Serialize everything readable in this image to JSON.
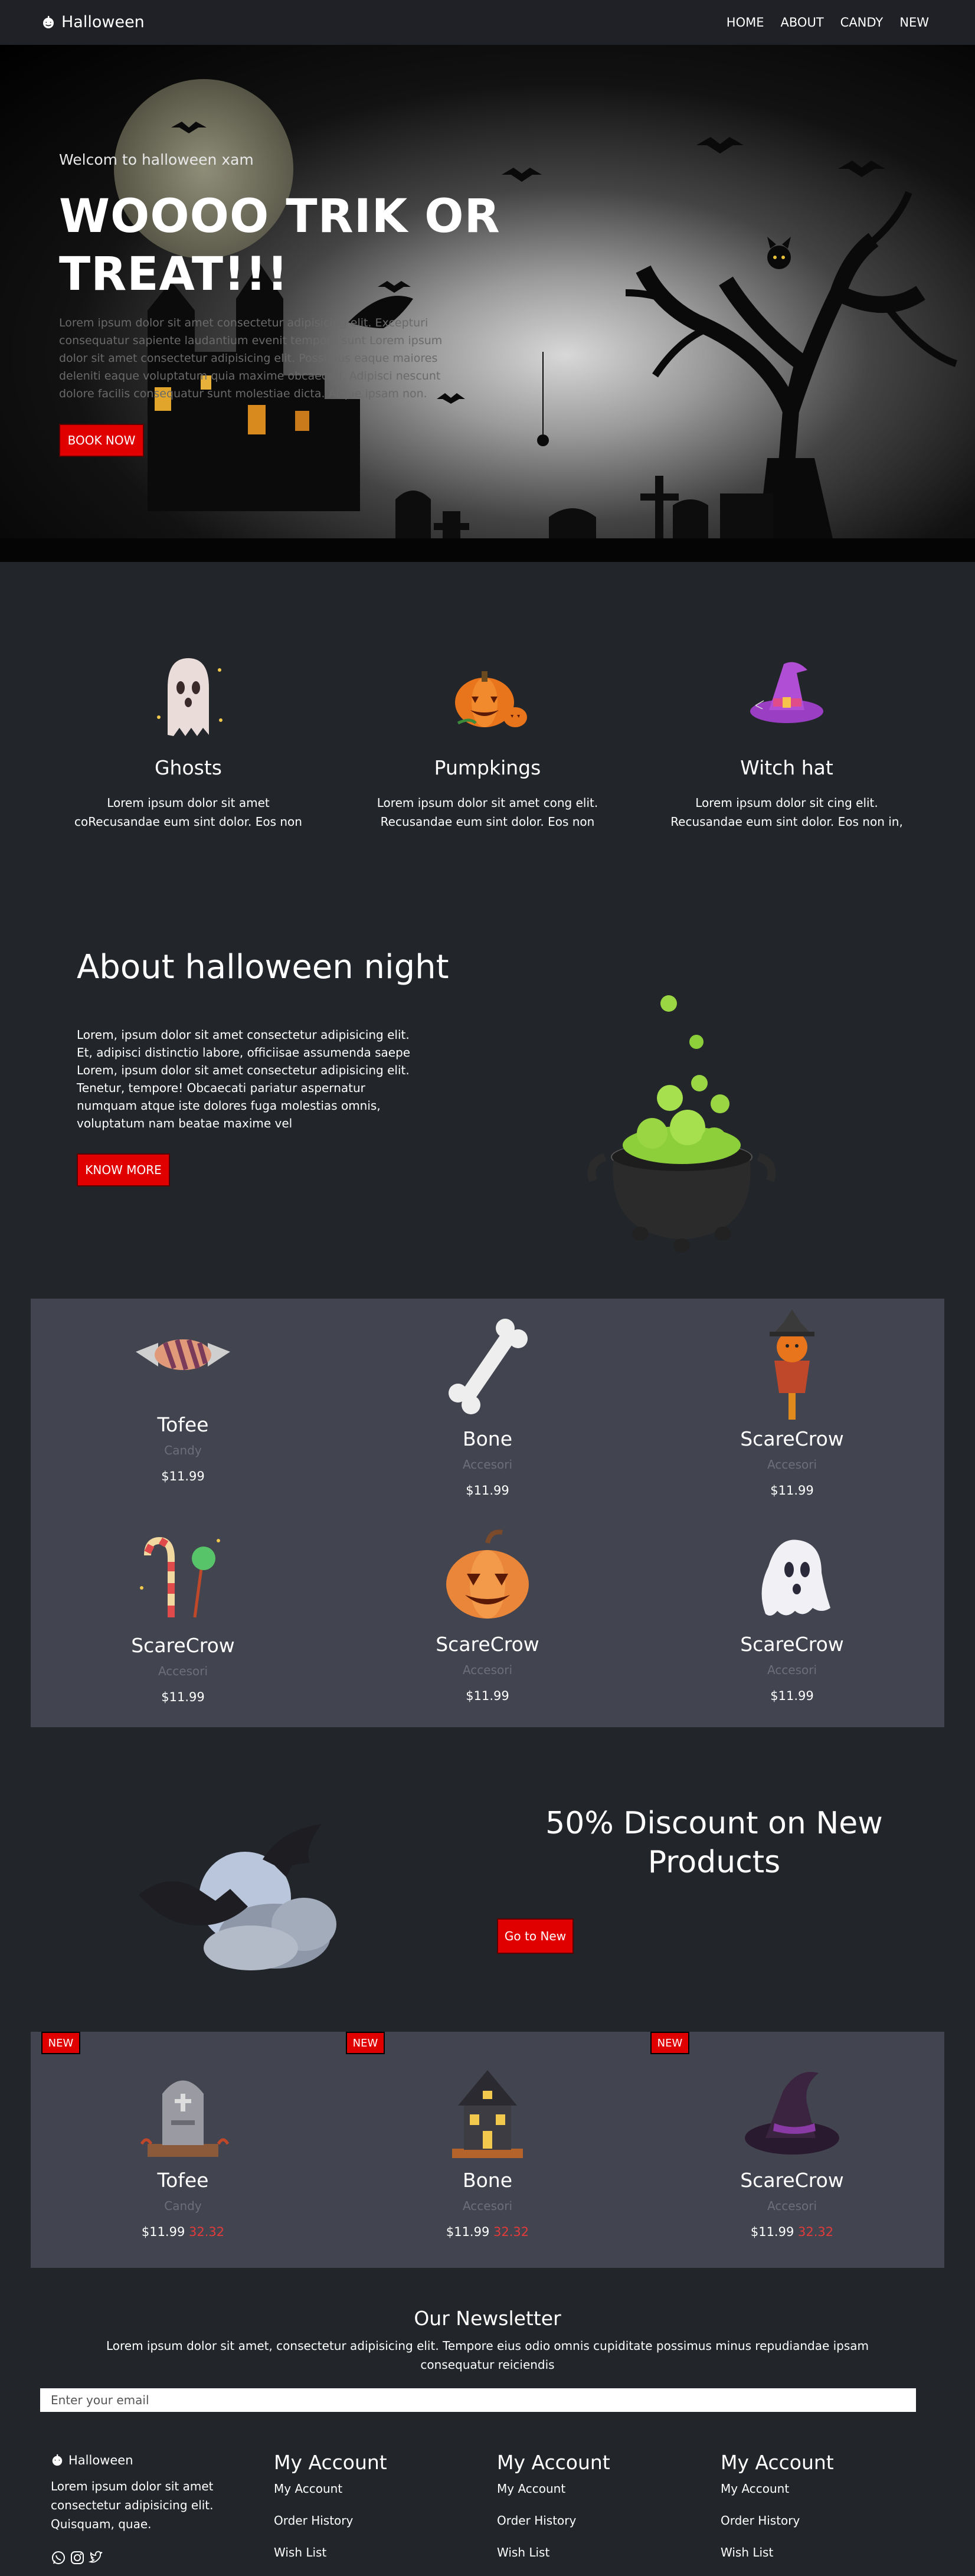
{
  "nav": {
    "brand": "Halloween",
    "links": [
      "HOME",
      "ABOUT",
      "CANDY",
      "NEW"
    ]
  },
  "hero": {
    "welcome": "Welcom to halloween xam",
    "title": "WOOOO TRIK OR TREAT!!!",
    "text": "Lorem ipsum dolor sit amet consectetur adipisicing elit. Excepturi consequatur sapiente laudantium evenit tempore sunt Lorem ipsum dolor sit amet consectetur adipisicing elit. Possimus eaque maiores deleniti eaque voluptatum quia maxime obcaecati. Adipisci nescunt dolore facilis consequatur sunt molestiae dicta. Atque ipsam non.",
    "button": "BOOK NOW"
  },
  "features": [
    {
      "title": "Ghosts",
      "text": "Lorem ipsum dolor sit amet coRecusandae eum sint dolor. Eos non",
      "icon": "ghost-icon"
    },
    {
      "title": "Pumpkings",
      "text": "Lorem ipsum dolor sit amet cong elit. Recusandae eum sint dolor. Eos non",
      "icon": "pumpkin-icon"
    },
    {
      "title": "Witch hat",
      "text": "Lorem ipsum dolor sit cing elit. Recusandae eum sint dolor. Eos non in,",
      "icon": "witch-hat-icon"
    }
  ],
  "about": {
    "title": "About halloween night",
    "text": "Lorem, ipsum dolor sit amet consectetur adipisicing elit. Et, adipisci distinctio labore, officiisae assumenda saepe Lorem, ipsum dolor sit amet consectetur adipisicing elit. Tenetur, tempore! Obcaecati pariatur aspernatur numquam atque iste dolores fuga molestias omnis, voluptatum nam beatae maxime vel",
    "button": "KNOW MORE"
  },
  "products": [
    {
      "name": "Tofee",
      "category": "Candy",
      "price": "$11.99",
      "icon": "candy-icon"
    },
    {
      "name": "Bone",
      "category": "Accesori",
      "price": "$11.99",
      "icon": "bone-icon"
    },
    {
      "name": "ScareCrow",
      "category": "Accesori",
      "price": "$11.99",
      "icon": "scarecrow-icon"
    },
    {
      "name": "ScareCrow",
      "category": "Accesori",
      "price": "$11.99",
      "icon": "candy-cane-icon"
    },
    {
      "name": "ScareCrow",
      "category": "Accesori",
      "price": "$11.99",
      "icon": "jack-o-lantern-icon"
    },
    {
      "name": "ScareCrow",
      "category": "Accesori",
      "price": "$11.99",
      "icon": "ghost-icon"
    }
  ],
  "discount": {
    "title": "50% Discount on New Products",
    "button": "Go to New"
  },
  "new_products": [
    {
      "badge": "NEW",
      "name": "Tofee",
      "category": "Candy",
      "price": "$11.99",
      "old_price": "32.32",
      "icon": "tombstone-icon"
    },
    {
      "badge": "NEW",
      "name": "Bone",
      "category": "Accesori",
      "price": "$11.99",
      "old_price": "32.32",
      "icon": "haunted-house-icon"
    },
    {
      "badge": "NEW",
      "name": "ScareCrow",
      "category": "Accesori",
      "price": "$11.99",
      "old_price": "32.32",
      "icon": "witch-hat-icon"
    }
  ],
  "newsletter": {
    "title": "Our Newsletter",
    "text": "Lorem ipsum dolor sit amet, consectetur adipisicing elit. Tempore eius odio omnis cupiditate possimus minus repudiandae ipsam consequatur reiciendis",
    "placeholder": "Enter your email"
  },
  "footer": {
    "brand": "Halloween",
    "text": "Lorem ipsum dolor sit amet consectetur adipisicing elit. Quisquam, quae.",
    "social": [
      "whatsapp-icon",
      "instagram-icon",
      "twitter-icon"
    ],
    "columns": [
      {
        "title": "My Account",
        "links": [
          "My Account",
          "Order History",
          "Wish List"
        ]
      },
      {
        "title": "My Account",
        "links": [
          "My Account",
          "Order History",
          "Wish List"
        ]
      },
      {
        "title": "My Account",
        "links": [
          "My Account",
          "Order History",
          "Wish List"
        ]
      }
    ]
  },
  "colors": {
    "background": "#22252a",
    "nav": "#1f2126",
    "panel": "#42444f",
    "accent": "#e00000",
    "old_price": "#e23b3b"
  }
}
